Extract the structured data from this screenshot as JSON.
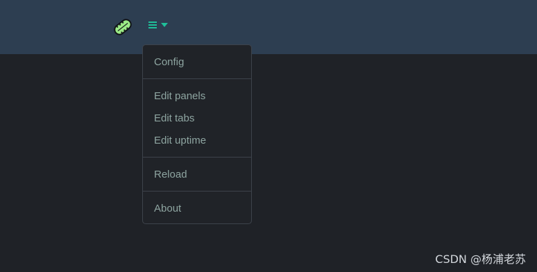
{
  "header": {
    "brand_icon": "surfboard-logo-icon",
    "menu_icon": "hamburger-icon",
    "caret_icon": "caret-down-icon",
    "accent_color": "#1fbf99",
    "background_color": "#2d3e51"
  },
  "menu": {
    "items": [
      {
        "label": "Config"
      },
      {
        "label": "Edit panels"
      },
      {
        "label": "Edit tabs"
      },
      {
        "label": "Edit uptime"
      },
      {
        "label": "Reload"
      },
      {
        "label": "About"
      }
    ]
  },
  "watermark": {
    "text": "CSDN @杨浦老苏"
  }
}
